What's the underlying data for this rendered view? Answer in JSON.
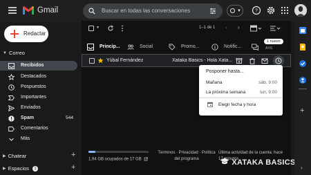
{
  "app": {
    "name": "Gmail"
  },
  "search": {
    "placeholder": "Buscar en todas las conversaciones"
  },
  "sidebar": {
    "compose_label": "Redactar",
    "section_mail": "Correo",
    "items": [
      {
        "label": "Recibidos",
        "icon": "inbox-icon",
        "active": true
      },
      {
        "label": "Destacados",
        "icon": "star-icon"
      },
      {
        "label": "Pospuestos",
        "icon": "clock-icon"
      },
      {
        "label": "Importantes",
        "icon": "label-important-icon"
      },
      {
        "label": "Enviados",
        "icon": "send-icon"
      },
      {
        "label": "Spam",
        "icon": "spam-icon",
        "count": "544"
      },
      {
        "label": "Comentarios",
        "icon": "label-icon"
      },
      {
        "label": "Más",
        "icon": "chevron-down-icon"
      }
    ],
    "section_chat": "Chatear",
    "section_spaces": "Espacios",
    "spaces_badge": "1"
  },
  "toolbar": {
    "pagination": "1–1 de 1"
  },
  "tabs": [
    {
      "label": "Princip...",
      "icon": "inbox-icon",
      "active": true
    },
    {
      "label": "Social",
      "icon": "people-icon"
    },
    {
      "label": "Promo...",
      "icon": "tag-icon"
    },
    {
      "label": "Notific...",
      "icon": "info-icon"
    },
    {
      "label": "",
      "icon": "forum-icon"
    }
  ],
  "new_badge": "1 nuevo",
  "new_badge_sub": "AHS",
  "email": {
    "sender": "Yúbal Fernández",
    "subject": "Xataka Basics - Hola Xata..."
  },
  "snooze_menu": {
    "title": "Posponer hasta...",
    "options": [
      {
        "label": "Mañana",
        "time": "sáb, 9:00"
      },
      {
        "label": "La próxima semana",
        "time": "lun, 9:00"
      }
    ],
    "custom_label": "Elegir fecha y hora"
  },
  "footer": {
    "storage": "1,94 GB ocupados de 17 GB",
    "storage_fraction": 0.114,
    "links": "Términos · Privacidad · Política del programa",
    "activity": "Última actividad de la cuenta: hace 17 minutos"
  },
  "watermark": "XATAKA BASICS",
  "colors": {
    "background": "#1a1a1a",
    "accent_blue": "#8ab4f8",
    "gmail_red": "#ea4335"
  }
}
